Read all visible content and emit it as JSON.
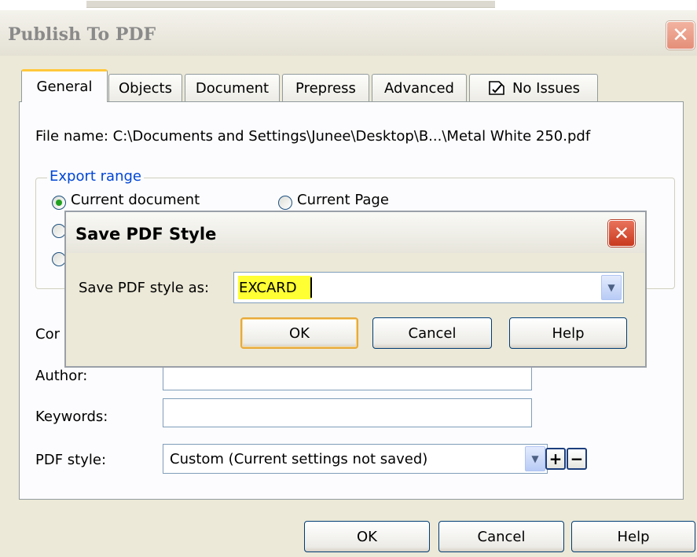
{
  "main_window": {
    "title": "Publish To PDF",
    "close_glyph": "✕"
  },
  "tabs": [
    {
      "label": "General",
      "active": true
    },
    {
      "label": "Objects",
      "active": false
    },
    {
      "label": "Document",
      "active": false
    },
    {
      "label": "Prepress",
      "active": false
    },
    {
      "label": "Advanced",
      "active": false
    },
    {
      "label": "No Issues",
      "icon": "issues-icon",
      "active": false
    }
  ],
  "general": {
    "file_name": "File name:  C:\\Documents and Settings\\Junee\\Desktop\\B...\\Metal White 250.pdf",
    "export_range": {
      "legend": "Export range",
      "options": [
        {
          "label": "Current document",
          "checked": true
        },
        {
          "label": "Current Page",
          "checked": false
        },
        {
          "label": "",
          "checked": false
        },
        {
          "label": "",
          "checked": false
        }
      ]
    },
    "fields": {
      "compatibility_label": "Cor",
      "author_label": "Author:",
      "keywords_label": "Keywords:",
      "pdf_style_label": "PDF style:",
      "pdf_style_value": "Custom (Current settings not saved)"
    },
    "plus_label": "+",
    "minus_label": "−"
  },
  "main_buttons": {
    "ok": "OK",
    "cancel": "Cancel",
    "help": "Help"
  },
  "save_dialog": {
    "title": "Save PDF Style",
    "close_glyph": "✕",
    "label": "Save PDF style as:",
    "input_value": "EXCARD",
    "highlight_color": "#ffff33",
    "buttons": {
      "ok": "OK",
      "cancel": "Cancel",
      "help": "Help"
    }
  },
  "dropdown_glyph": "▼"
}
